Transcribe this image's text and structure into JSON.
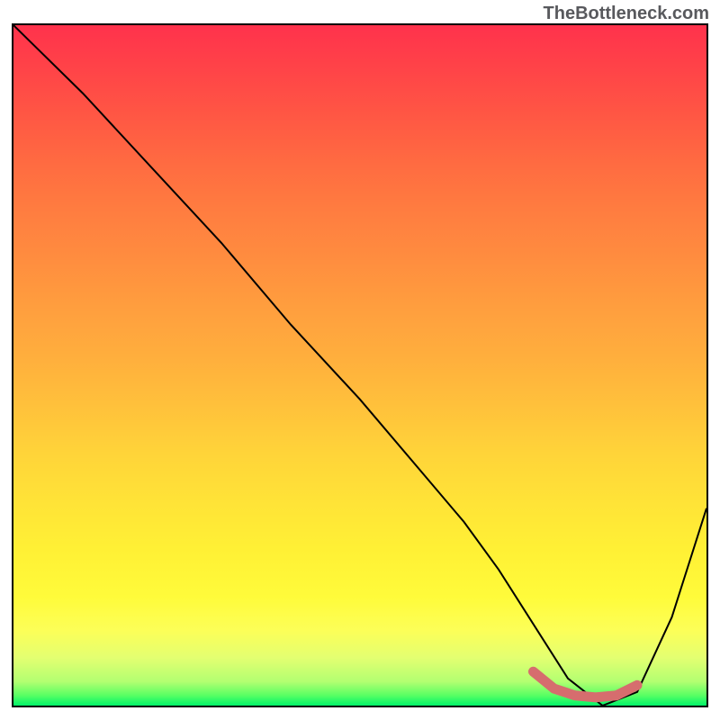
{
  "watermark": "TheBottleneck.com",
  "chart_data": {
    "type": "line",
    "title": "",
    "xlabel": "",
    "ylabel": "",
    "xlim": [
      0,
      100
    ],
    "ylim": [
      0,
      100
    ],
    "series": [
      {
        "name": "main-curve",
        "color": "#000000",
        "x": [
          0,
          3,
          10,
          20,
          30,
          40,
          50,
          60,
          65,
          70,
          75,
          80,
          85,
          90,
          95,
          100
        ],
        "y": [
          100,
          97,
          90,
          79,
          68,
          56,
          45,
          33,
          27,
          20,
          12,
          4,
          0,
          2,
          13,
          29
        ]
      },
      {
        "name": "highlight-region",
        "color": "#d66d6e",
        "x": [
          75,
          78,
          81,
          84,
          87,
          90
        ],
        "y": [
          5,
          2.5,
          1.5,
          1.2,
          1.5,
          3
        ]
      }
    ]
  }
}
